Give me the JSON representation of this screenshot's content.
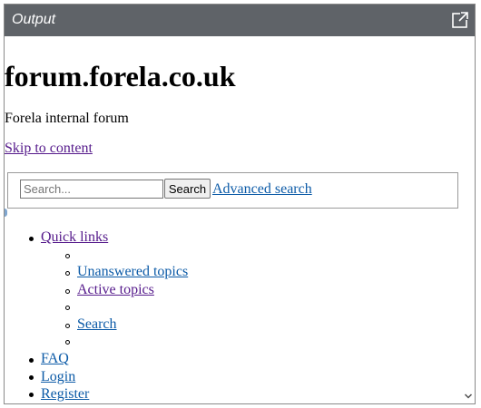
{
  "panel": {
    "title": "Output",
    "popout_icon": "external-link-icon"
  },
  "page": {
    "site_title": "forum.forela.co.uk",
    "site_description": "Forela internal forum",
    "skip_link": "Skip to content"
  },
  "search": {
    "placeholder": "Search...",
    "value": "",
    "button_label": "Search",
    "advanced_label": "Advanced search"
  },
  "nav": {
    "quick_links": "Quick links",
    "sub_items": [
      "",
      "Unanswered topics",
      "Active topics",
      "",
      "Search",
      ""
    ],
    "faq": "FAQ",
    "login": "Login",
    "register": "Register"
  },
  "colors": {
    "header_bg": "#5f6368",
    "link": "#0b5aa7",
    "visited_link": "#551a8b"
  }
}
